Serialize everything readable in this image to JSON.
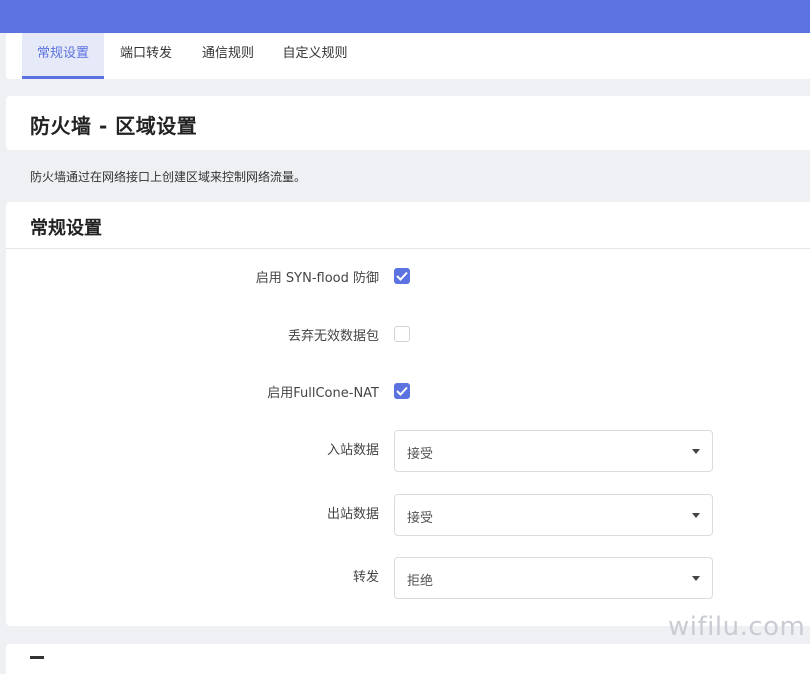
{
  "tabs": [
    {
      "label": "常规设置",
      "active": true
    },
    {
      "label": "端口转发",
      "active": false
    },
    {
      "label": "通信规则",
      "active": false
    },
    {
      "label": "自定义规则",
      "active": false
    }
  ],
  "page": {
    "title": "防火墙 - 区域设置",
    "description": "防火墙通过在网络接口上创建区域来控制网络流量。"
  },
  "general": {
    "heading": "常规设置",
    "syn_flood": {
      "label": "启用 SYN-flood 防御",
      "checked": true
    },
    "drop_invalid": {
      "label": "丢弃无效数据包",
      "checked": false
    },
    "fullcone": {
      "label": "启用FullCone-NAT",
      "checked": true
    },
    "input": {
      "label": "入站数据",
      "value": "接受"
    },
    "output": {
      "label": "出站数据",
      "value": "接受"
    },
    "forward": {
      "label": "转发",
      "value": "拒绝"
    }
  },
  "watermark": "wifilu.com",
  "colors": {
    "accent": "#5b72e0",
    "background": "#eef0f4"
  }
}
